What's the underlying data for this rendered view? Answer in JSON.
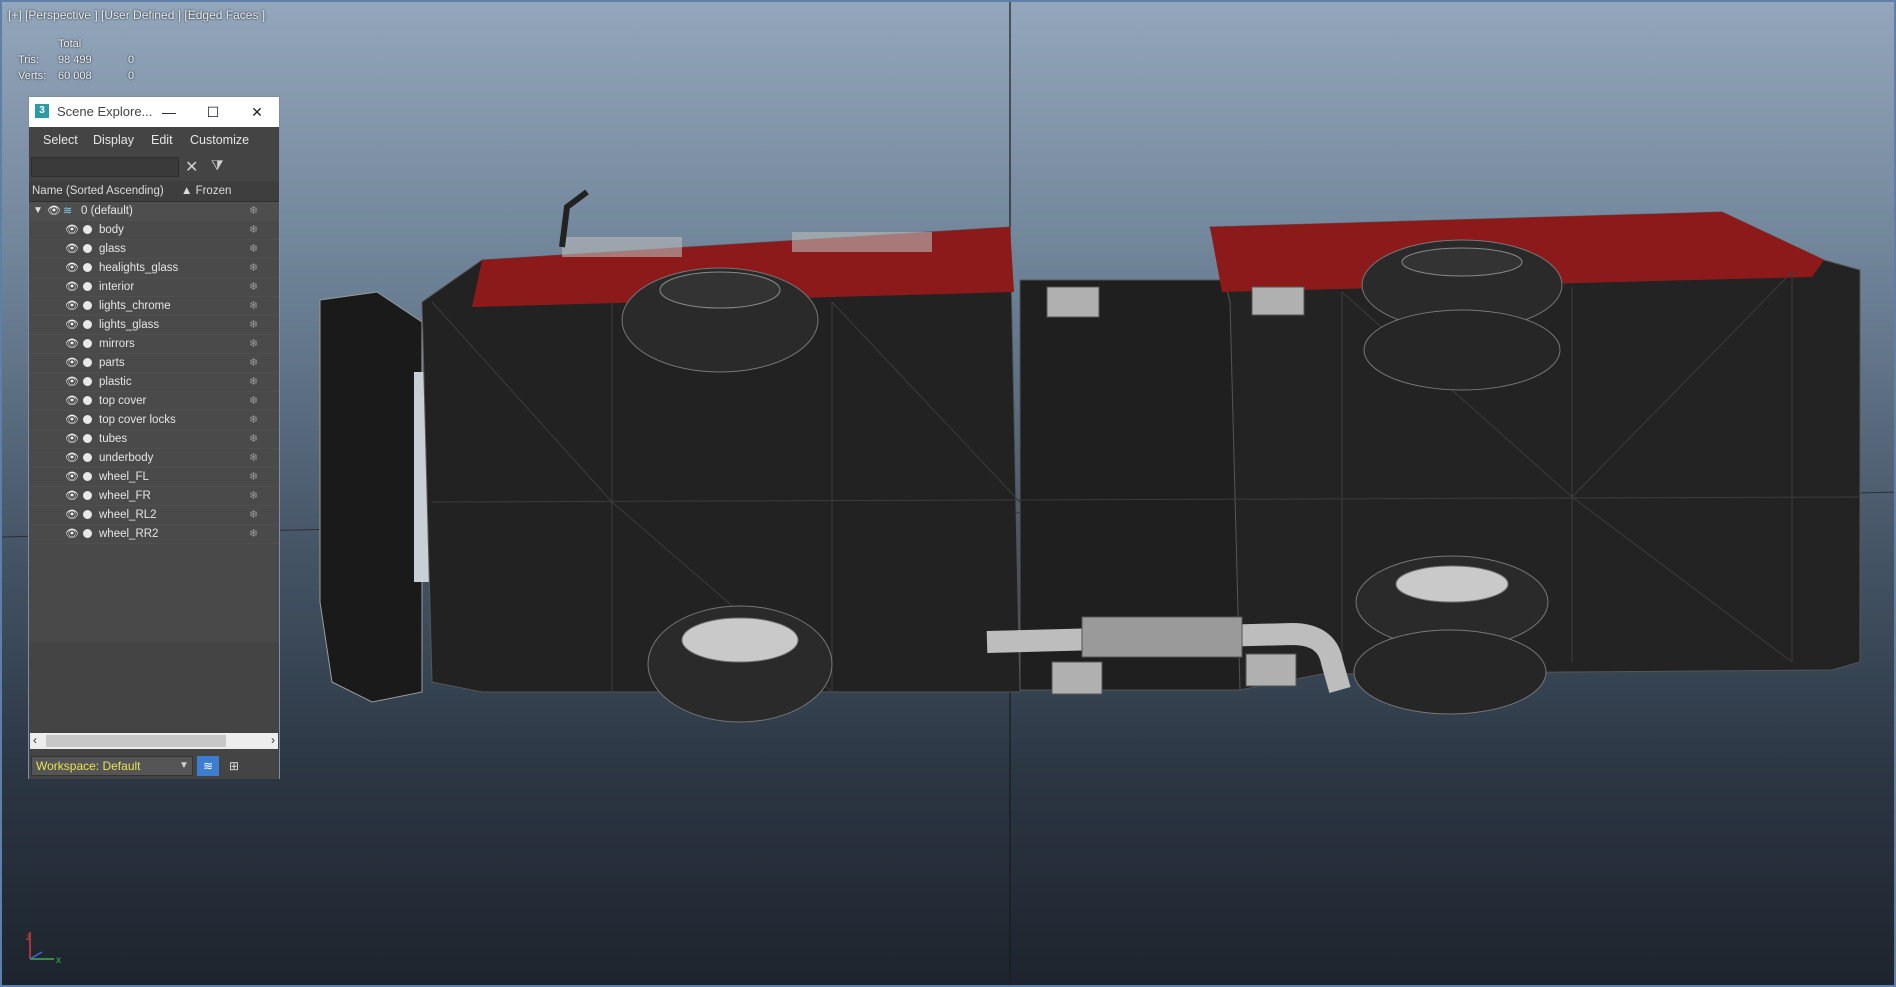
{
  "viewport": {
    "label": "[+] [Perspective ] [User Defined ] [Edged Faces ]",
    "stats": {
      "header": "Total",
      "tris_label": "Tris:",
      "tris_value": "98 499",
      "tris_selected": "0",
      "verts_label": "Verts:",
      "verts_value": "60 008",
      "verts_selected": "0"
    },
    "axis_labels": {
      "x": "x",
      "z": "z"
    },
    "object": "truck-model-edged-faces"
  },
  "scene_explorer": {
    "title": "Scene Explore...",
    "app_icon": "3",
    "window_buttons": {
      "minimize": "—",
      "maximize": "☐",
      "close": "✕"
    },
    "menu": [
      "Select",
      "Display",
      "Edit",
      "Customize"
    ],
    "search": {
      "value": "",
      "placeholder": ""
    },
    "columns": {
      "name": "Name (Sorted Ascending)",
      "frozen": "▲ Frozen"
    },
    "layer": "0 (default)",
    "objects": [
      "body",
      "glass",
      "healights_glass",
      "interior",
      "lights_chrome",
      "lights_glass",
      "mirrors",
      "parts",
      "plastic",
      "top cover",
      "top cover locks",
      "tubes",
      "underbody",
      "wheel_FL",
      "wheel_FR",
      "wheel_RL2",
      "wheel_RR2"
    ],
    "workspace": "Workspace: Default",
    "icons": {
      "eye": "eye-icon",
      "frozen": "snowflake-icon",
      "layer": "layer-stack-icon",
      "filter": "filter-icon",
      "clear": "clear-icon"
    }
  },
  "colors": {
    "viewport_border": "#5d7fa9",
    "truck_body": "#1e1e1e",
    "truck_red": "#8c1a1a",
    "workspace_text": "#e7e35a",
    "active_button": "#3b7ed1"
  }
}
